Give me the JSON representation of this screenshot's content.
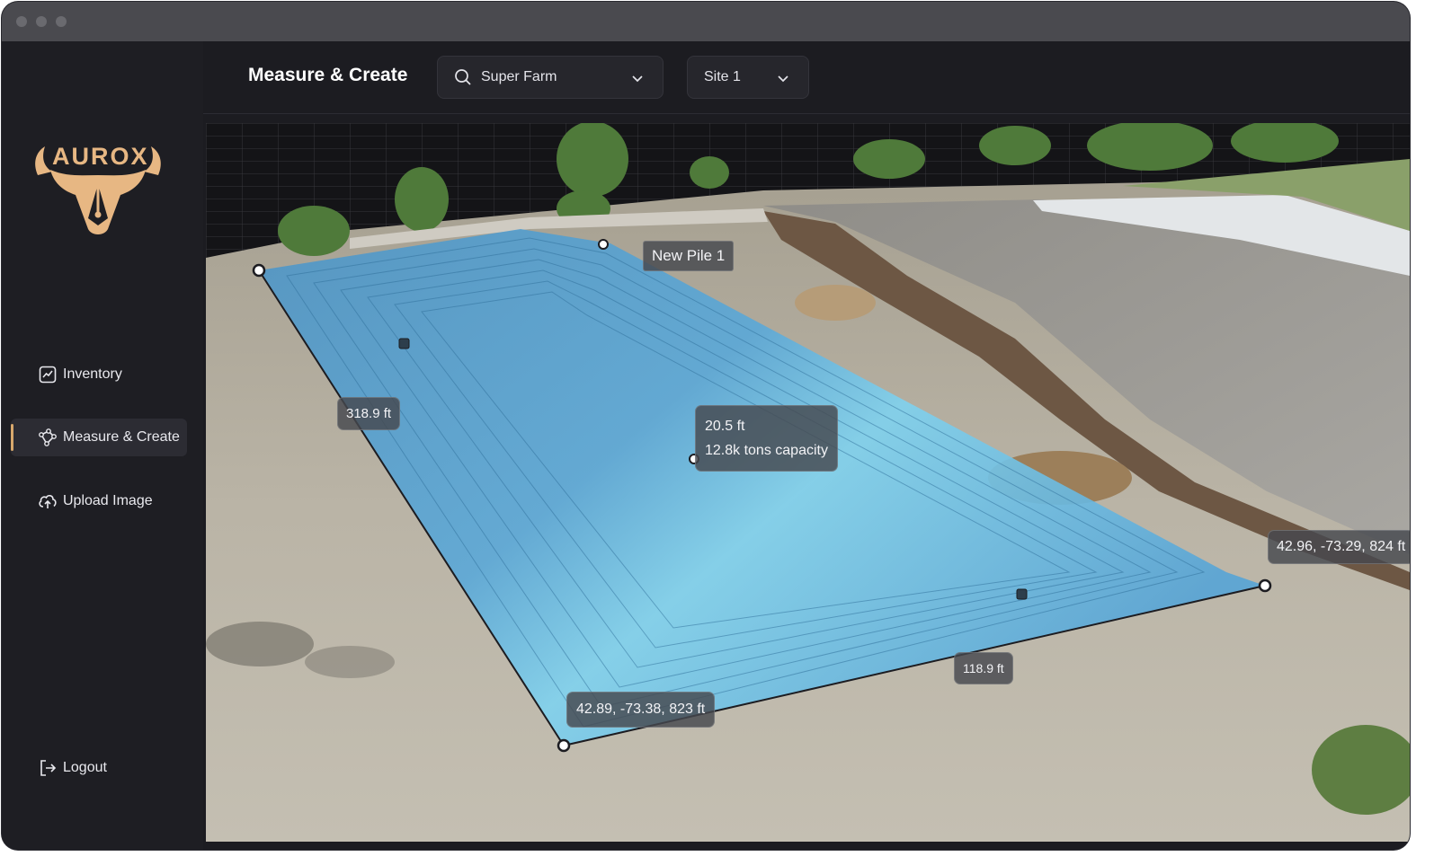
{
  "window": {
    "title_dots": [
      "close",
      "minimize",
      "maximize"
    ]
  },
  "brand": {
    "name": "AUROX",
    "logo_icon": "bull-head-pen-icon",
    "color": "#e7b783"
  },
  "sidebar": {
    "items": [
      {
        "label": "Inventory",
        "icon": "chart-icon",
        "active": false
      },
      {
        "label": "Measure & Create",
        "icon": "node-shape-icon",
        "active": true
      },
      {
        "label": "Upload Image",
        "icon": "cloud-upload-icon",
        "active": false
      }
    ],
    "logout_label": "Logout",
    "accent_color": "#d8a86c"
  },
  "header": {
    "title": "Measure & Create",
    "farm_select": {
      "value": "Super Farm",
      "icon": "search-icon"
    },
    "site_select": {
      "value": "Site 1"
    }
  },
  "viewport": {
    "pile_name": "New Pile 1",
    "dim_length": "318.9 ft",
    "dim_width": "118.9 ft",
    "height_label": "20.5 ft",
    "capacity_label": "12.8k tons capacity",
    "coord_bottom_left": "42.89, -73.38, 823 ft",
    "coord_right": "42.96, -73.29, 824 ft",
    "pile_color": "#5aa8d8"
  }
}
